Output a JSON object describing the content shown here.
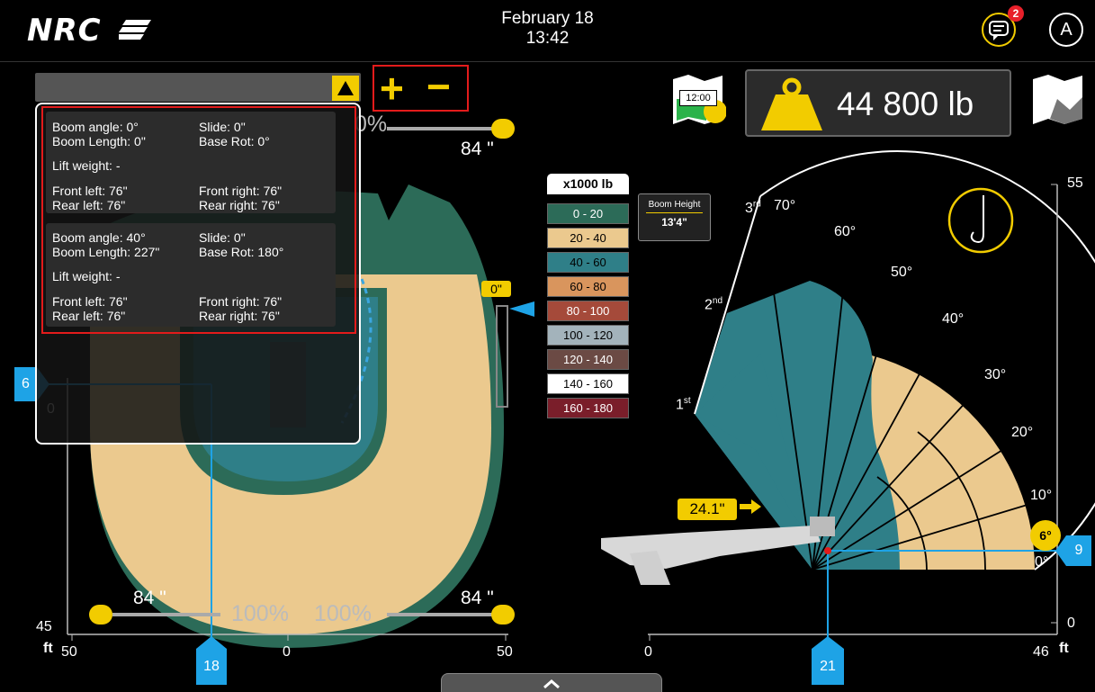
{
  "header": {
    "logo": "NRC",
    "date": "February 18",
    "time": "13:42",
    "notification_count": "2",
    "avatar_initial": "A"
  },
  "zoom": {
    "plus": "+",
    "minus": "−"
  },
  "load": {
    "weight": "44 800 lb",
    "map_time": "12:00"
  },
  "info_panel": {
    "positions": [
      {
        "boom_angle": "Boom angle: 0°",
        "slide": "Slide: 0\"",
        "boom_length": "Boom Length: 0\"",
        "base_rot": "Base Rot: 0°",
        "lift_weight": "Lift weight: -",
        "front_left": "Front left: 76\"",
        "front_right": "Front right: 76\"",
        "rear_left": "Rear left: 76\"",
        "rear_right": "Rear right: 76\""
      },
      {
        "boom_angle": "Boom angle: 40°",
        "slide": "Slide: 0\"",
        "boom_length": "Boom Length: 227\"",
        "base_rot": "Base Rot: 180°",
        "lift_weight": "Lift weight: -",
        "front_left": "Front left: 76\"",
        "front_right": "Front right: 76\"",
        "rear_left": "Rear left: 76\"",
        "rear_right": "Rear right: 76\""
      }
    ]
  },
  "legend": {
    "title": "x1000 lb",
    "items": [
      {
        "label": "0 - 20",
        "color": "#2c6b58",
        "text": "#ffffff"
      },
      {
        "label": "20 - 40",
        "color": "#ebc98e",
        "text": "#000000"
      },
      {
        "label": "40 - 60",
        "color": "#2f7f88",
        "text": "#000000"
      },
      {
        "label": "60 - 80",
        "color": "#d9955d",
        "text": "#000000"
      },
      {
        "label": "80 - 100",
        "color": "#a54a3a",
        "text": "#ffffff"
      },
      {
        "label": "100 - 120",
        "color": "#a3b3bb",
        "text": "#000000"
      },
      {
        "label": "120 - 140",
        "color": "#6b4a44",
        "text": "#ffffff"
      },
      {
        "label": "140 - 160",
        "color": "#ffffff",
        "text": "#000000"
      },
      {
        "label": "160 - 180",
        "color": "#7a1e2a",
        "text": "#ffffff"
      }
    ]
  },
  "boom_height": {
    "label": "Boom Height",
    "value": "13'4\""
  },
  "top_view": {
    "percent_top": "0%",
    "inches_top": "84 \"",
    "slide_value": "0\"",
    "left_marker": "6",
    "bottom_marker": "18",
    "y_top_partial": "0",
    "y_bottom": "45",
    "unit": "ft",
    "x_left": "50",
    "x_mid": "0",
    "x_right": "50",
    "bl_inches": "84 \"",
    "bl_percent": "100%",
    "br_percent": "100%",
    "br_inches": "84 \""
  },
  "side_view": {
    "angle_labels": [
      "70°",
      "60°",
      "50°",
      "40°",
      "30°",
      "20°",
      "10°",
      "0°"
    ],
    "section_1st": "1st",
    "section_2nd": "2nd",
    "section_3rd": "3rd",
    "extension": "24.1\"",
    "current_angle": "6°",
    "right_marker": "9",
    "bottom_marker": "21",
    "y_top": "55",
    "y_bottom": "0",
    "x_left": "0",
    "x_right": "46",
    "unit": "ft"
  },
  "colors": {
    "accent": "#f2cc00",
    "marker": "#1ea3e6",
    "highlight": "#e31b1b"
  }
}
